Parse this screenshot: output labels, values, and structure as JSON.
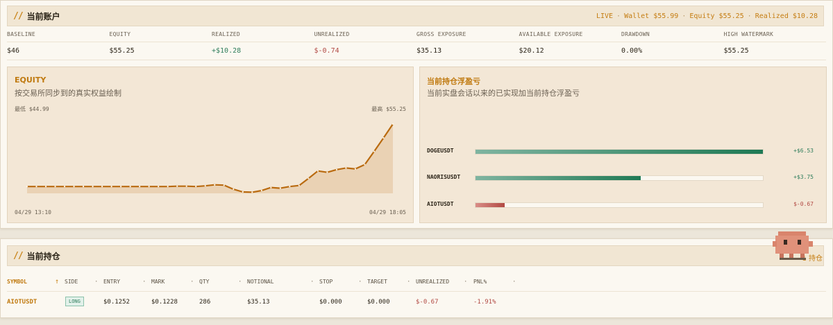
{
  "account": {
    "title": "当前账户",
    "status": {
      "mode": "LIVE",
      "wallet": "Wallet $55.99",
      "equity": "Equity $55.25",
      "realized": "Realized $10.28"
    },
    "metric_labels": [
      "BASELINE",
      "EQUITY",
      "REALIZED",
      "UNREALIZED",
      "GROSS EXPOSURE",
      "AVAILABLE EXPOSURE",
      "DRAWDOWN",
      "HIGH WATERMARK"
    ],
    "metric_values": [
      "$46",
      "$55.25",
      "+$10.28",
      "$-0.74",
      "$35.13",
      "$20.12",
      "0.00%",
      "$55.25"
    ]
  },
  "equity_card": {
    "title": "EQUITY",
    "subtitle": "按交易所同步到的真实权益绘制",
    "min_label": "最低 $44.99",
    "max_label": "最高 $55.25",
    "start_time": "04/29 13:10",
    "end_time": "04/29 18:05"
  },
  "chart_data": {
    "type": "area",
    "title": "EQUITY",
    "xlabel": "",
    "ylabel": "",
    "x_range": [
      "04/29 13:10",
      "04/29 18:05"
    ],
    "ylim": [
      44.99,
      55.25
    ],
    "values": [
      46.0,
      46.0,
      46.0,
      46.0,
      46.0,
      46.0,
      46.0,
      46.0,
      46.0,
      46.0,
      46.0,
      46.0,
      46.0,
      46.0,
      46.0,
      46.0,
      46.05,
      46.05,
      46.0,
      46.1,
      46.25,
      46.2,
      45.6,
      45.2,
      45.15,
      45.4,
      45.85,
      45.75,
      46.0,
      46.15,
      47.2,
      48.3,
      48.1,
      48.5,
      48.75,
      48.6,
      49.25,
      51.2,
      53.2,
      55.25
    ],
    "color": "#b96a0f",
    "fill": "#ead2b4",
    "grid": false
  },
  "pnl_card": {
    "title": "当前持仓浮盈亏",
    "subtitle": "当前实盘会话以来的已实现加当前持仓浮盈亏",
    "rows": [
      {
        "symbol": "DOGEUSDT",
        "value": "+$6.53",
        "amount": 6.53,
        "direction": "up"
      },
      {
        "symbol": "NAORISUSDT",
        "value": "+$3.75",
        "amount": 3.75,
        "direction": "up"
      },
      {
        "symbol": "AIOTUSDT",
        "value": "$-0.67",
        "amount": -0.67,
        "direction": "down"
      }
    ],
    "colors": {
      "positive": "#1f7a55",
      "negative": "#b24a44"
    }
  },
  "positions": {
    "title": "当前持仓",
    "count_label": "1 持仓",
    "columns": [
      "SYMBOL",
      "SIDE",
      "ENTRY",
      "MARK",
      "QTY",
      "NOTIONAL",
      "STOP",
      "TARGET",
      "UNREALIZED",
      "PNL%"
    ],
    "sort_icon": "arrow-up-icon",
    "rows": [
      {
        "symbol": "AIOTUSDT",
        "side": "LONG",
        "entry": "$0.1252",
        "mark": "$0.1228",
        "qty": "286",
        "notional": "$35.13",
        "stop": "$0.000",
        "target": "$0.000",
        "unrealized": "$-0.67",
        "pnl_pct": "-1.91%"
      }
    ]
  }
}
